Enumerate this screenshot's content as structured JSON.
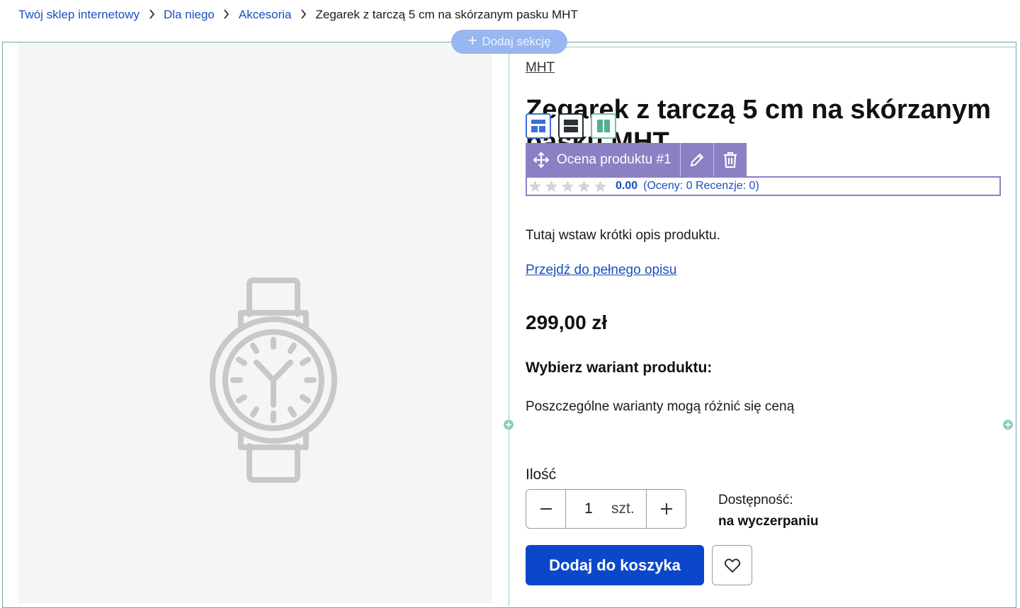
{
  "breadcrumb": {
    "items": [
      "Twój sklep internetowy",
      "Dla niego",
      "Akcesoria"
    ],
    "current": "Zegarek z tarczą 5 cm na skórzanym pasku MHT"
  },
  "editor": {
    "add_section_label": "Dodaj sekcję",
    "module_label": "Ocena produktu #1"
  },
  "product": {
    "brand": "MHT",
    "title": "Zegarek z tarczą 5 cm na skórzanym pasku MHT",
    "title_tail": "pasku MHT",
    "rating": {
      "stars_filled": 0,
      "stars_total": 5,
      "value": "0.00",
      "counts": "(Oceny: 0 Recenzje: 0)"
    },
    "short_description": "Tutaj wstaw krótki opis produktu.",
    "full_description_link": "Przejdź do pełnego opisu",
    "price": "299,00 zł",
    "variant_heading": "Wybierz wariant produktu:",
    "variant_note": "Poszczególne warianty mogą różnić się ceną",
    "quantity": {
      "label": "Ilość",
      "value": "1",
      "unit": "szt."
    },
    "availability": {
      "label": "Dostępność:",
      "value": "na wyczerpaniu"
    },
    "add_to_cart_label": "Dodaj do koszyka"
  },
  "colors": {
    "primary": "#0d47c9",
    "link": "#1a4fbd",
    "editor_module": "#8a80c4",
    "editor_section": "#98b6f0",
    "editor_column": "#96cfc0"
  }
}
